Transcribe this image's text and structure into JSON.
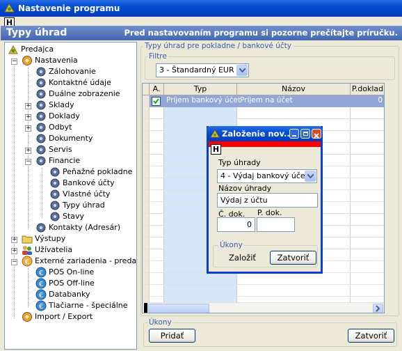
{
  "window": {
    "title": "Nastavenie programu",
    "toolbar_button": "H"
  },
  "header": {
    "title": "Typy úhrad",
    "notice": "Pred nastavovaním programu si pozorne prečítajte príručku."
  },
  "tree": {
    "root": "Predajca",
    "nastavenia": "Nastavenia",
    "zalohovanie": "Zálohovanie",
    "kontaktne": "Kontaktné údaje",
    "dualne": "Duálne zobrazenie",
    "sklady": "Sklady",
    "doklady": "Doklady",
    "odbyt": "Odbyt",
    "dokumenty": "Dokumenty",
    "servis": "Servis",
    "financie": "Financie",
    "penazne": "Peňažné pokladne",
    "bankove": "Bankové účty",
    "vlastne": "Vlastné účty",
    "typy": "Typy úhrad",
    "stavy": "Stavy",
    "kontakty": "Kontakty (Adresár)",
    "vystupy": "Výstupy",
    "uzivatelia": "Užívatelia",
    "externe": "Externé zariadenia - predaj",
    "pos_online": "POS On-line",
    "pos_offline": "POS Off-line",
    "databanky": "Databanky",
    "tlaciarne": "Tlačiarne - špeciálne",
    "import": "Import / Export"
  },
  "main": {
    "group_title": "Typy úhrad pre pokladne / bankové účty",
    "filter_label": "Filtre",
    "filter_value": "3 - Štandardný EUR",
    "columns": [
      "A.",
      "Typ",
      "Názov",
      "P.doklad"
    ],
    "rows": [
      {
        "active": true,
        "typ": "Príjem bankový účet",
        "nazov": "Príjem  na účet",
        "pdoklad": "0"
      }
    ],
    "actions_label": "Úkony",
    "add_button": "Pridať",
    "close_button": "Zatvoriť"
  },
  "dialog": {
    "title": "Založenie nov...",
    "toolbar_button": "H",
    "typ_label": "Typ úhrady",
    "typ_value": "4 - Výdaj bankový účet",
    "nazov_label": "Názov úhrady",
    "nazov_value": "Výdaj z účtu",
    "cdok_label": "Č. dok.",
    "cdok_value": "0",
    "pdok_label": "P. dok.",
    "pdok_value": "",
    "actions_label": "Úkony",
    "create_button": "Založiť",
    "close_button": "Zatvoriť"
  },
  "colors": {
    "titlebar": "#0a52d6",
    "header_band": "#5577bb",
    "selected_row": "#93a6d8",
    "accent_red": "#ff0000"
  }
}
